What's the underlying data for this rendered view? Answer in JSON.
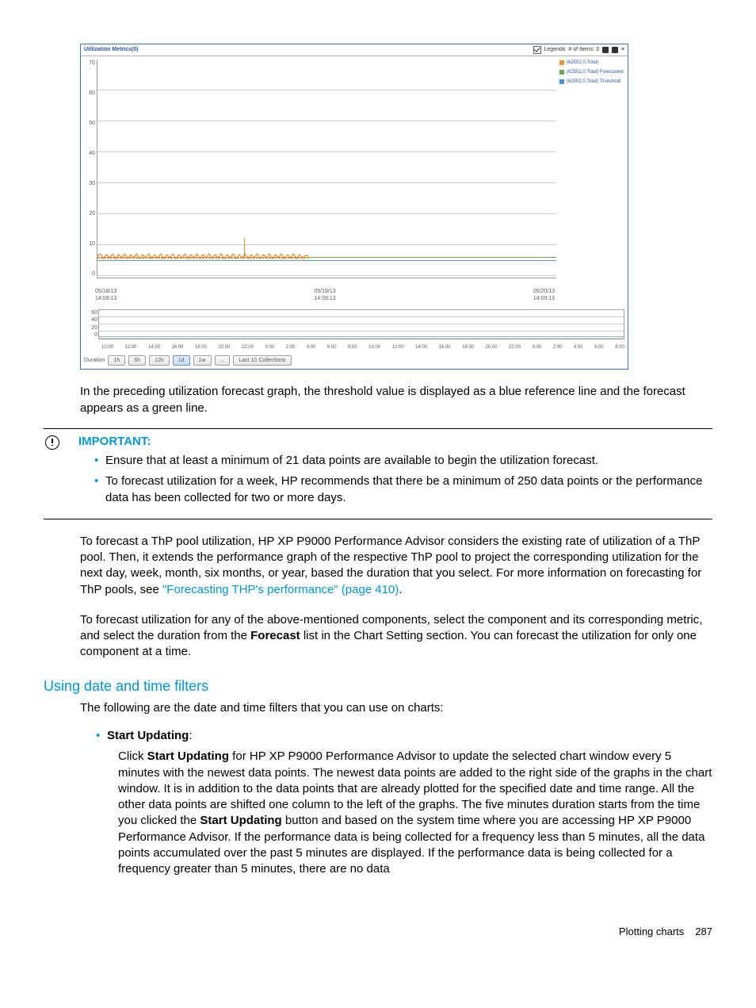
{
  "chart_data": {
    "title": "Utilization Metrics(0)",
    "type": "line",
    "ylim": [
      0,
      70
    ],
    "yticks": [
      70,
      60,
      50,
      40,
      30,
      20,
      10,
      0
    ],
    "x_start": {
      "date": "05/18/13",
      "time": "14:09:13"
    },
    "x_mid": {
      "date": "05/19/13",
      "time": "14:09:13"
    },
    "x_end": {
      "date": "05/20/13",
      "time": "14:09:13"
    },
    "series": [
      {
        "name": "(62552,0,Total)",
        "role": "actual",
        "approx_value": 6
      },
      {
        "name": "(62552,0,Total) Forecasted",
        "role": "forecast",
        "approx_value": 6
      },
      {
        "name": "(62552,0,Total) Threshold",
        "role": "threshold",
        "approx_value": 5
      }
    ],
    "legends_checked": true,
    "items_count_label": "# of Items: 3",
    "nav": {
      "yticks": [
        60,
        40,
        20,
        0
      ],
      "xticks": [
        "10:00",
        "12:00",
        "14:00",
        "16:00",
        "18:00",
        "20:00",
        "22:00",
        "0:00",
        "2:00",
        "4:00",
        "6:00",
        "8:00",
        "10:00",
        "12:00",
        "14:00",
        "16:00",
        "18:00",
        "20:00",
        "22:00",
        "0:00",
        "2:00",
        "4:00",
        "6:00",
        "8:00"
      ]
    },
    "duration": {
      "label": "Duration",
      "buttons": [
        "1h",
        "6h",
        "12h",
        "1d",
        "1w",
        "..."
      ],
      "active": "1d",
      "last": "Last 10 Collections"
    }
  },
  "legends_label": "Legends",
  "paragraphs": {
    "intro": "In the preceding utilization forecast graph, the threshold value is displayed as a blue reference line and the forecast appears as a green line.",
    "thp": "To forecast a ThP pool utilization, HP XP P9000 Performance Advisor considers the existing rate of utilization of a ThP pool. Then, it extends the performance graph of the respective ThP pool to project the corresponding utilization for the next day, week, month, six months, or year, based the duration that you select. For more information on forecasting for ThP pools, see ",
    "thp_link": "\"Forecasting THP's performance\" (page 410)",
    "thp_suffix": ".",
    "forecast_sel_a": "To forecast utilization for any of the above-mentioned components, select the component and its corresponding metric, and select the duration from the ",
    "forecast_bold": "Forecast",
    "forecast_sel_b": " list in the Chart Setting section. You can forecast the utilization for only one component at a time.",
    "filters_intro": "The following are the date and time filters that you can use on charts:"
  },
  "important": {
    "title": "IMPORTANT:",
    "items": [
      "Ensure that at least a minimum of 21 data points are available to begin the utilization forecast.",
      "To forecast utilization for a week, HP recommends that there be a minimum of 250 data points or the performance data has been collected for two or more days."
    ]
  },
  "section": {
    "title": "Using date and time filters",
    "bullet_label": "Start Updating",
    "bullet_colon": ":",
    "bullet_body_a": "Click ",
    "bullet_bold1": "Start Updating",
    "bullet_body_b": " for HP XP P9000 Performance Advisor to update the selected chart window every 5 minutes with the newest data points. The newest data points are added to the right side of the graphs in the chart window. It is in addition to the data points that are already plotted for the specified date and time range. All the other data points are shifted one column to the left of the graphs. The five minutes duration starts from the time you clicked the ",
    "bullet_bold2": "Start Updating",
    "bullet_body_c": " button and based on the system time where you are accessing HP XP P9000 Performance Advisor. If the performance data is being collected for a frequency less than 5 minutes, all the data points accumulated over the past 5 minutes are displayed. If the performance data is being collected for a frequency greater than 5 minutes, there are no data"
  },
  "footer": {
    "label": "Plotting charts",
    "page": "287"
  }
}
